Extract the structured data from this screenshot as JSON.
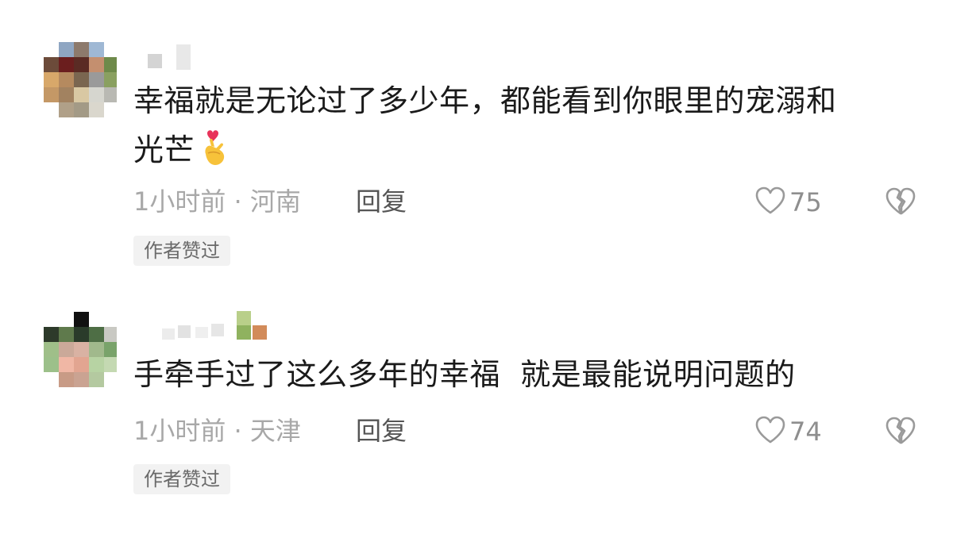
{
  "comments": [
    {
      "text_line1": "幸福就是无论过了多少年，都能看到你眼里的宠溺和",
      "text_line2": "光芒",
      "emoji": "finger-heart-emoji",
      "time": "1小时前",
      "separator": "·",
      "location": "河南",
      "reply_label": "回复",
      "likes": "75",
      "badge": "作者赞过"
    },
    {
      "text_line1": "手牵手过了这么多年的幸福  就是最能说明问题的",
      "time": "1小时前",
      "separator": "·",
      "location": "天津",
      "reply_label": "回复",
      "likes": "74",
      "badge": "作者赞过"
    }
  ],
  "icons": {
    "like": "heart-outline-icon",
    "dislike": "broken-heart-icon"
  },
  "colors": {
    "text": "#1a1a1a",
    "meta": "#a8a8a8",
    "reply": "#555555",
    "badge_bg": "#f2f2f2"
  }
}
